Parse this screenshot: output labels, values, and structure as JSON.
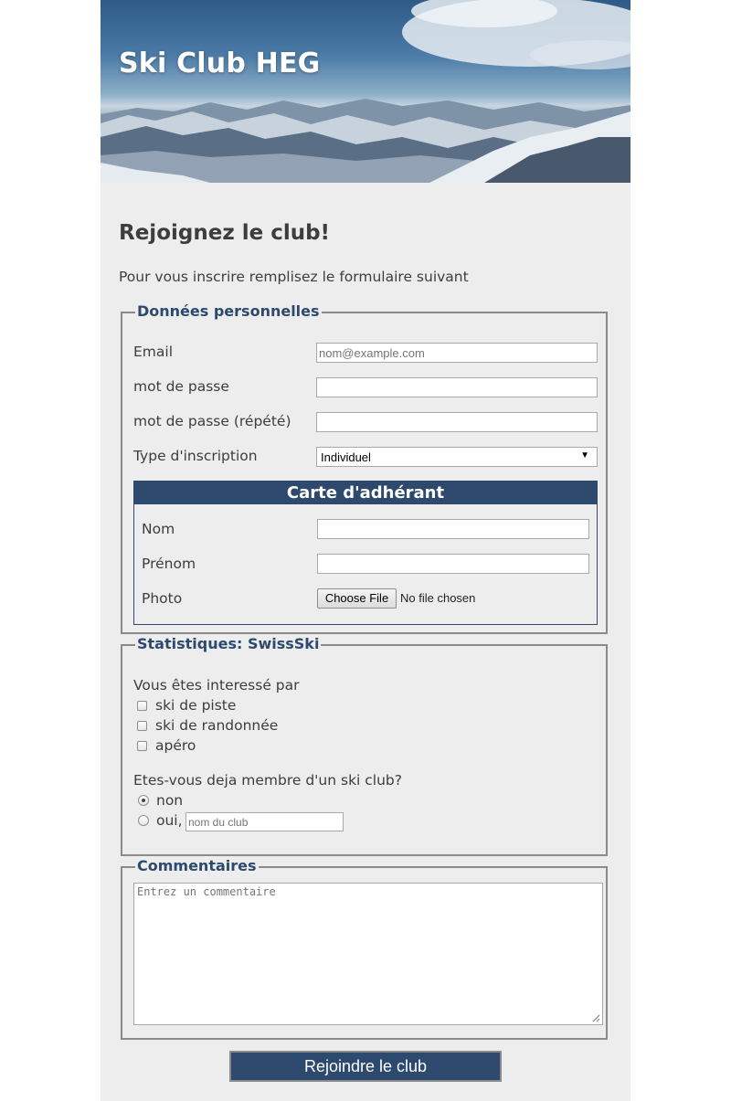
{
  "header": {
    "site_title": "Ski Club HEG"
  },
  "main": {
    "heading": "Rejoignez le club!",
    "intro": "Pour vous inscrire remplisez le formulaire suivant"
  },
  "personal": {
    "legend": "Données personnelles",
    "email_label": "Email",
    "email_placeholder": "nom@example.com",
    "password_label": "mot de passe",
    "password_repeat_label": "mot de passe (répété)",
    "type_label": "Type d'inscription",
    "type_value": "Individuel",
    "type_arrow": "▼"
  },
  "card": {
    "title": "Carte d'adhérant",
    "nom_label": "Nom",
    "prenom_label": "Prénom",
    "photo_label": "Photo",
    "file_button": "Choose File",
    "file_status": "No file chosen"
  },
  "stats": {
    "legend": "Statistiques: SwissSki",
    "interest_question": "Vous êtes interessé par",
    "interests": [
      "ski de piste",
      "ski de randonnée",
      "apéro"
    ],
    "member_question": "Etes-vous deja membre d'un ski club?",
    "member_no": "non",
    "member_yes": "oui,",
    "club_placeholder": "nom du club",
    "selected": "non"
  },
  "comments": {
    "legend": "Commentaires",
    "placeholder": "Entrez un commentaire"
  },
  "submit_label": "Rejoindre le club",
  "colors": {
    "accent": "#2d4a6e",
    "page_bg": "#ededed"
  }
}
